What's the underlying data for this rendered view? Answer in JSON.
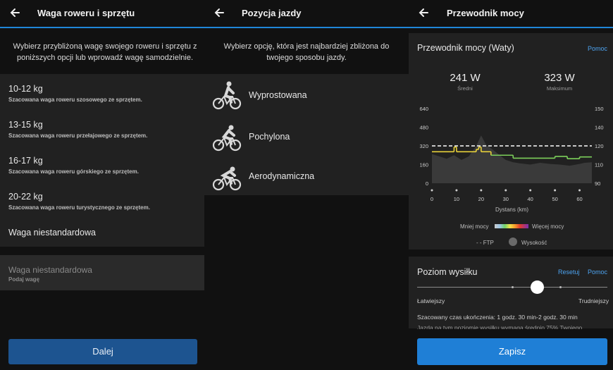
{
  "screen1": {
    "title": "Waga roweru i sprzętu",
    "intro": "Wybierz przybliżoną wagę swojego roweru i sprzętu z poniższych opcji lub wprowadź wagę samodzielnie.",
    "options": [
      {
        "label": "10-12 kg",
        "sub": "Szacowana waga roweru szosowego ze sprzętem."
      },
      {
        "label": "13-15 kg",
        "sub": "Szacowana waga roweru przełajowego ze sprzętem."
      },
      {
        "label": "16-17 kg",
        "sub": "Szacowana waga roweru górskiego ze sprzętem."
      },
      {
        "label": "20-22 kg",
        "sub": "Szacowana waga roweru turystycznego ze sprzętem."
      }
    ],
    "custom_option": "Waga niestandardowa",
    "custom_field_placeholder": "Waga niestandardowa",
    "custom_field_hint": "Podaj wagę",
    "next_button": "Dalej"
  },
  "screen2": {
    "title": "Pozycja jazdy",
    "intro": "Wybierz opcję, która jest najbardziej zbliżona do twojego sposobu jazdy.",
    "positions": [
      {
        "label": "Wyprostowana",
        "icon": "cyclist-upright-icon"
      },
      {
        "label": "Pochylona",
        "icon": "cyclist-leaning-icon"
      },
      {
        "label": "Aerodynamiczna",
        "icon": "cyclist-aero-icon"
      }
    ]
  },
  "screen3": {
    "title": "Przewodnik mocy",
    "card_title": "Przewodnik mocy (Waty)",
    "help_link": "Pomoc",
    "stats": [
      {
        "value": "241 W",
        "label": "Średni"
      },
      {
        "value": "323 W",
        "label": "Maksimum"
      }
    ],
    "legend": {
      "less": "Mniej mocy",
      "more": "Więcej mocy",
      "ftp": "FTP",
      "elevation": "Wysokość"
    },
    "effort": {
      "title": "Poziom wysiłku",
      "reset": "Resetuj",
      "help": "Pomoc",
      "easier": "Łatwiejszy",
      "harder": "Trudniejszy",
      "estimate": "Szacowany czas ukończenia: 1 godz. 30 min-2 godz. 30 min",
      "note": "Jazda na tym poziomie wysiłku wymaga średnio 75% Twojego"
    },
    "save_button": "Zapisz",
    "colors": {
      "accent": "#1f7fd6",
      "ftp_line": "#ffffff",
      "power_yellow": "#e8d23a",
      "power_green": "#7ccf5a",
      "elevation_fill": "#3a3a3a"
    }
  },
  "chart_data": {
    "type": "line",
    "title": "Przewodnik mocy (Waty)",
    "xlabel": "Dystans (km)",
    "ylabel": "",
    "x_ticks": [
      0,
      10,
      20,
      30,
      40,
      50,
      60
    ],
    "xlim": [
      0,
      65
    ],
    "y_left_ticks": [
      0,
      160,
      320,
      480,
      640
    ],
    "ylim": [
      0,
      640
    ],
    "y_right_ticks": [
      90,
      110,
      120,
      140,
      150
    ],
    "ftp": 320,
    "series": [
      {
        "name": "power",
        "x": [
          0,
          9,
          9,
          10,
          10,
          18,
          18,
          19,
          19,
          20,
          20,
          24,
          24,
          33,
          33,
          50,
          50,
          55,
          55,
          60,
          60,
          65
        ],
        "y": [
          270,
          270,
          310,
          310,
          270,
          270,
          290,
          290,
          310,
          310,
          270,
          270,
          240,
          240,
          215,
          215,
          230,
          230,
          210,
          210,
          225,
          225
        ]
      }
    ],
    "elevation": {
      "x": [
        0,
        3,
        6,
        9,
        12,
        15,
        18,
        20,
        22,
        24,
        27,
        30,
        33,
        36,
        40,
        44,
        48,
        52,
        56,
        60,
        62,
        65
      ],
      "y": [
        250,
        230,
        210,
        240,
        200,
        230,
        320,
        410,
        330,
        300,
        250,
        200,
        180,
        170,
        160,
        175,
        165,
        160,
        150,
        165,
        175,
        180
      ]
    }
  }
}
